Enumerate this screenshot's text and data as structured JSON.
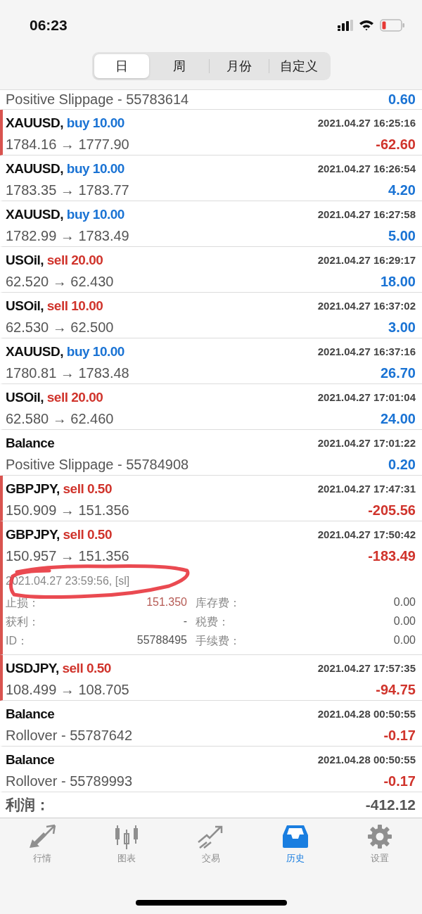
{
  "status_bar": {
    "time": "06:23"
  },
  "segments": [
    {
      "label": "日",
      "selected": true
    },
    {
      "label": "周",
      "selected": false
    },
    {
      "label": "月份",
      "selected": false
    },
    {
      "label": "自定义",
      "selected": false
    }
  ],
  "rows": [
    {
      "kind": "balance",
      "comment": "Positive Slippage - 55783614",
      "profit": "0.60",
      "loss": false
    },
    {
      "kind": "trade",
      "symbol": "XAUUSD,",
      "action": {
        "kind": "buy",
        "text": "buy 10.00"
      },
      "time": "2021.04.27 16:25:16",
      "prices": "1784.16 → 1777.90",
      "profit": "-62.60",
      "loss": true
    },
    {
      "kind": "trade",
      "symbol": "XAUUSD,",
      "action": {
        "kind": "buy",
        "text": "buy 10.00"
      },
      "time": "2021.04.27 16:26:54",
      "prices": "1783.35 → 1783.77",
      "profit": "4.20",
      "loss": false
    },
    {
      "kind": "trade",
      "symbol": "XAUUSD,",
      "action": {
        "kind": "buy",
        "text": "buy 10.00"
      },
      "time": "2021.04.27 16:27:58",
      "prices": "1782.99 → 1783.49",
      "profit": "5.00",
      "loss": false
    },
    {
      "kind": "trade",
      "symbol": "USOil,",
      "action": {
        "kind": "sell",
        "text": "sell 20.00"
      },
      "time": "2021.04.27 16:29:17",
      "prices": "62.520 → 62.430",
      "profit": "18.00",
      "loss": false
    },
    {
      "kind": "trade",
      "symbol": "USOil,",
      "action": {
        "kind": "sell",
        "text": "sell 10.00"
      },
      "time": "2021.04.27 16:37:02",
      "prices": "62.530 → 62.500",
      "profit": "3.00",
      "loss": false
    },
    {
      "kind": "trade",
      "symbol": "XAUUSD,",
      "action": {
        "kind": "buy",
        "text": "buy 10.00"
      },
      "time": "2021.04.27 16:37:16",
      "prices": "1780.81 → 1783.48",
      "profit": "26.70",
      "loss": false
    },
    {
      "kind": "trade",
      "symbol": "USOil,",
      "action": {
        "kind": "sell",
        "text": "sell 20.00"
      },
      "time": "2021.04.27 17:01:04",
      "prices": "62.580 → 62.460",
      "profit": "24.00",
      "loss": false
    },
    {
      "kind": "balance",
      "title": "Balance",
      "time": "2021.04.27 17:01:22",
      "comment": "Positive Slippage - 55784908",
      "profit": "0.20",
      "loss": false
    },
    {
      "kind": "trade",
      "symbol": "GBPJPY,",
      "action": {
        "kind": "sell",
        "text": "sell 0.50"
      },
      "time": "2021.04.27 17:47:31",
      "prices": "150.909 → 151.356",
      "profit": "-205.56",
      "loss": true
    },
    {
      "kind": "trade",
      "symbol": "GBPJPY,",
      "action": {
        "kind": "sell",
        "text": "sell 0.50"
      },
      "time": "2021.04.27 17:50:42",
      "prices": "150.957 → 151.356",
      "profit": "-183.49",
      "loss": true,
      "details": {
        "close_info": "2021.04.27 23:59:56, [sl]",
        "circled": true,
        "left": [
          {
            "label": "止损：",
            "value": "151.350",
            "accent": true
          },
          {
            "label": "获利：",
            "value": "-",
            "accent": false
          },
          {
            "label": "ID：",
            "value": "55788495",
            "accent": false
          }
        ],
        "right": [
          {
            "label": "库存费：",
            "value": "0.00"
          },
          {
            "label": "税费：",
            "value": "0.00"
          },
          {
            "label": "手续费：",
            "value": "0.00"
          }
        ]
      }
    },
    {
      "kind": "trade",
      "symbol": "USDJPY,",
      "action": {
        "kind": "sell",
        "text": "sell 0.50"
      },
      "time": "2021.04.27 17:57:35",
      "prices": "108.499 → 108.705",
      "profit": "-94.75",
      "loss": true
    },
    {
      "kind": "balance",
      "title": "Balance",
      "time": "2021.04.28 00:50:55",
      "comment": "Rollover - 55787642",
      "profit": "-0.17",
      "loss": true
    },
    {
      "kind": "balance",
      "title": "Balance",
      "time": "2021.04.28 00:50:55",
      "comment": "Rollover - 55789993",
      "profit": "-0.17",
      "loss": true
    }
  ],
  "total": {
    "label": "利润：",
    "value": "-412.12"
  },
  "tab_bar": [
    {
      "kind": "quotes",
      "label": "行情",
      "selected": false
    },
    {
      "kind": "chart",
      "label": "图表",
      "selected": false
    },
    {
      "kind": "trade",
      "label": "交易",
      "selected": false
    },
    {
      "kind": "history",
      "label": "历史",
      "selected": true
    },
    {
      "kind": "settings",
      "label": "设置",
      "selected": false
    }
  ]
}
